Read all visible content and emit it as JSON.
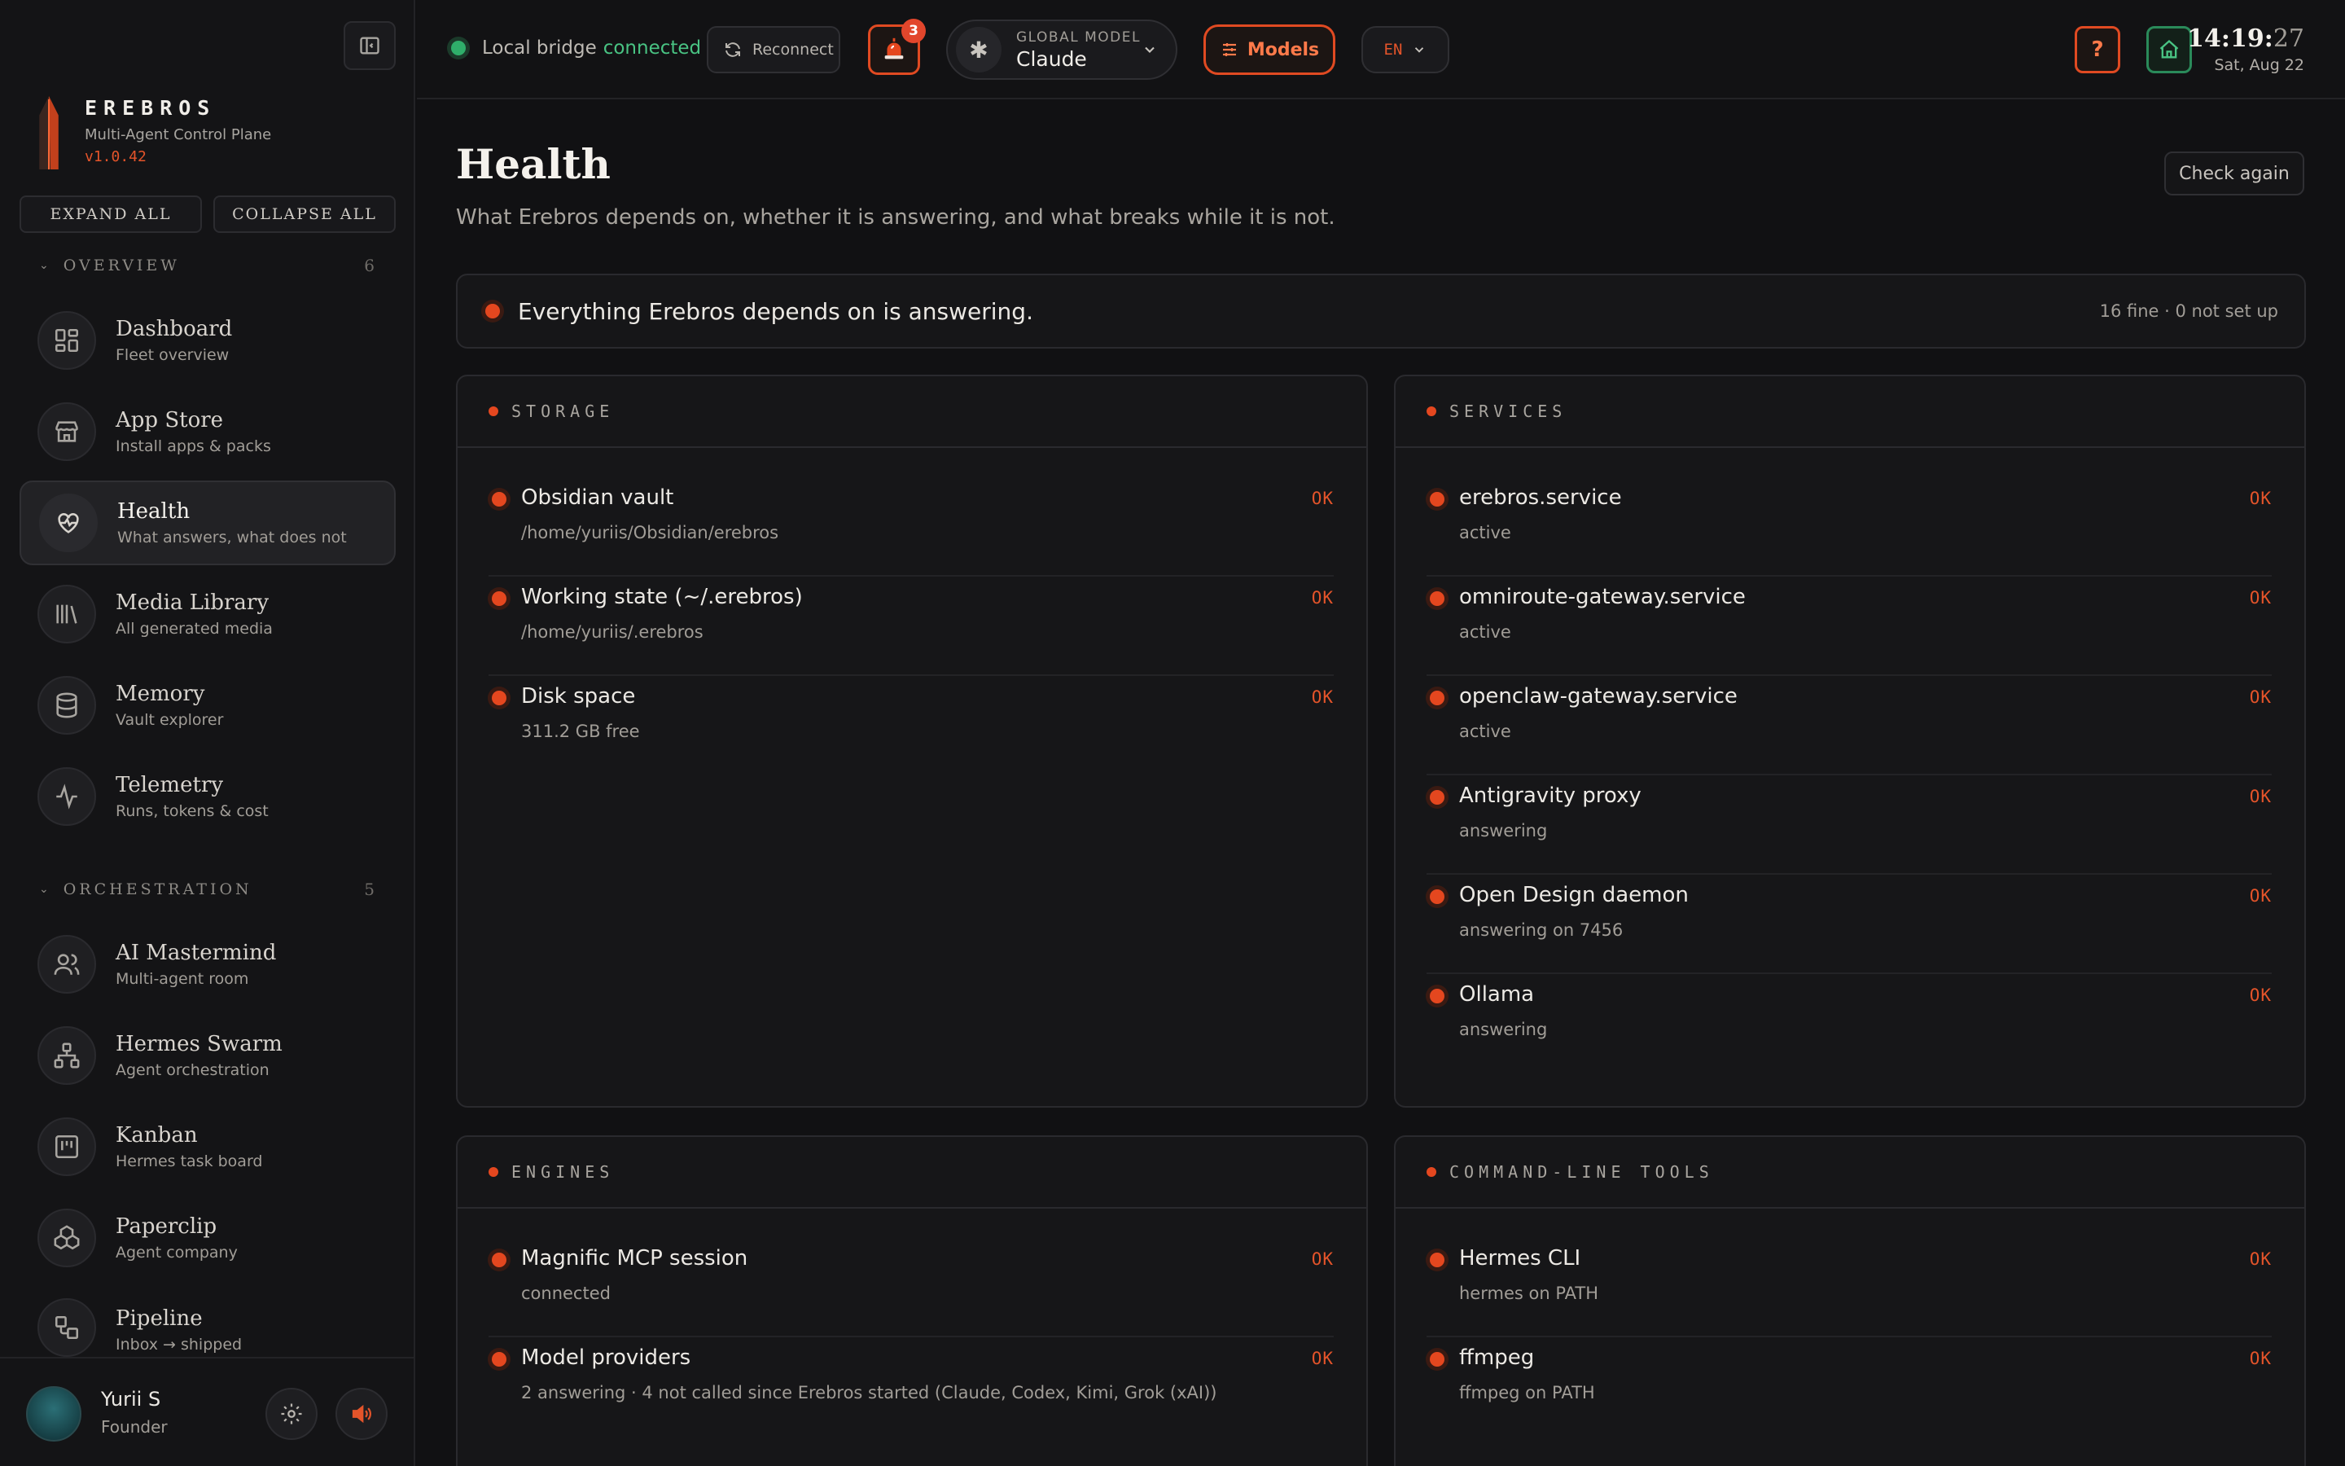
{
  "sidebar": {
    "brand": {
      "name": "EREBROS",
      "subtitle": "Multi-Agent Control Plane",
      "version": "v1.0.42"
    },
    "expand_all": "EXPAND ALL",
    "collapse_all": "COLLAPSE ALL",
    "sections": [
      {
        "title": "OVERVIEW",
        "count": "6",
        "items": [
          {
            "label": "Dashboard",
            "sub": "Fleet overview",
            "icon": "grid-icon"
          },
          {
            "label": "App Store",
            "sub": "Install apps & packs",
            "icon": "store-icon"
          },
          {
            "label": "Health",
            "sub": "What answers, what does not",
            "icon": "heart-pulse-icon",
            "active": true
          },
          {
            "label": "Media Library",
            "sub": "All generated media",
            "icon": "library-icon"
          },
          {
            "label": "Memory",
            "sub": "Vault explorer",
            "icon": "database-icon"
          },
          {
            "label": "Telemetry",
            "sub": "Runs, tokens & cost",
            "icon": "activity-icon"
          }
        ]
      },
      {
        "title": "ORCHESTRATION",
        "count": "5",
        "items": [
          {
            "label": "AI Mastermind",
            "sub": "Multi-agent room",
            "icon": "users-icon"
          },
          {
            "label": "Hermes Swarm",
            "sub": "Agent orchestration",
            "icon": "network-icon"
          },
          {
            "label": "Kanban",
            "sub": "Hermes task board",
            "icon": "kanban-icon"
          },
          {
            "label": "Paperclip",
            "sub": "Agent company",
            "icon": "boxes-icon"
          },
          {
            "label": "Pipeline",
            "sub": "Inbox → shipped",
            "icon": "workflow-icon"
          }
        ]
      }
    ],
    "user": {
      "name": "Yurii S",
      "role": "Founder"
    }
  },
  "topbar": {
    "bridge_label": "Local bridge",
    "bridge_status": "connected",
    "reconnect": "Reconnect",
    "alert_count": "3",
    "model_caption": "GLOBAL MODEL",
    "model_name": "Claude",
    "models_button": "Models",
    "language": "EN",
    "help": "?",
    "clock_hm": "14:19:",
    "clock_s": "27",
    "date": "Sat, Aug 22"
  },
  "main": {
    "title": "Health",
    "description": "What Erebros depends on, whether it is answering, and what breaks while it is not.",
    "check_again": "Check again",
    "summary": {
      "text": "Everything Erebros depends on is answering.",
      "counts": "16 fine · 0 not set up"
    },
    "cards": {
      "storage": {
        "title": "STORAGE",
        "rows": [
          {
            "name": "Obsidian vault",
            "sub": "/home/yuriis/Obsidian/erebros",
            "status": "OK"
          },
          {
            "name": "Working state (~/.erebros)",
            "sub": "/home/yuriis/.erebros",
            "status": "OK"
          },
          {
            "name": "Disk space",
            "sub": "311.2 GB free",
            "status": "OK"
          }
        ]
      },
      "services": {
        "title": "SERVICES",
        "rows": [
          {
            "name": "erebros.service",
            "sub": "active",
            "status": "OK"
          },
          {
            "name": "omniroute-gateway.service",
            "sub": "active",
            "status": "OK"
          },
          {
            "name": "openclaw-gateway.service",
            "sub": "active",
            "status": "OK"
          },
          {
            "name": "Antigravity proxy",
            "sub": "answering",
            "status": "OK"
          },
          {
            "name": "Open Design daemon",
            "sub": "answering on 7456",
            "status": "OK"
          },
          {
            "name": "Ollama",
            "sub": "answering",
            "status": "OK"
          }
        ]
      },
      "engines": {
        "title": "ENGINES",
        "rows": [
          {
            "name": "Magnific MCP session",
            "sub": "connected",
            "status": "OK"
          },
          {
            "name": "Model providers",
            "sub": "2 answering · 4 not called since Erebros started (Claude, Codex, Kimi, Grok (xAI))",
            "status": "OK"
          }
        ]
      },
      "cli": {
        "title": "COMMAND-LINE TOOLS",
        "rows": [
          {
            "name": "Hermes CLI",
            "sub": "hermes on PATH",
            "status": "OK"
          },
          {
            "name": "ffmpeg",
            "sub": "ffmpeg on PATH",
            "status": "OK"
          }
        ]
      }
    }
  },
  "colors": {
    "accent": "#e4471f",
    "ok_green": "#2fae6a",
    "background": "#111113"
  }
}
